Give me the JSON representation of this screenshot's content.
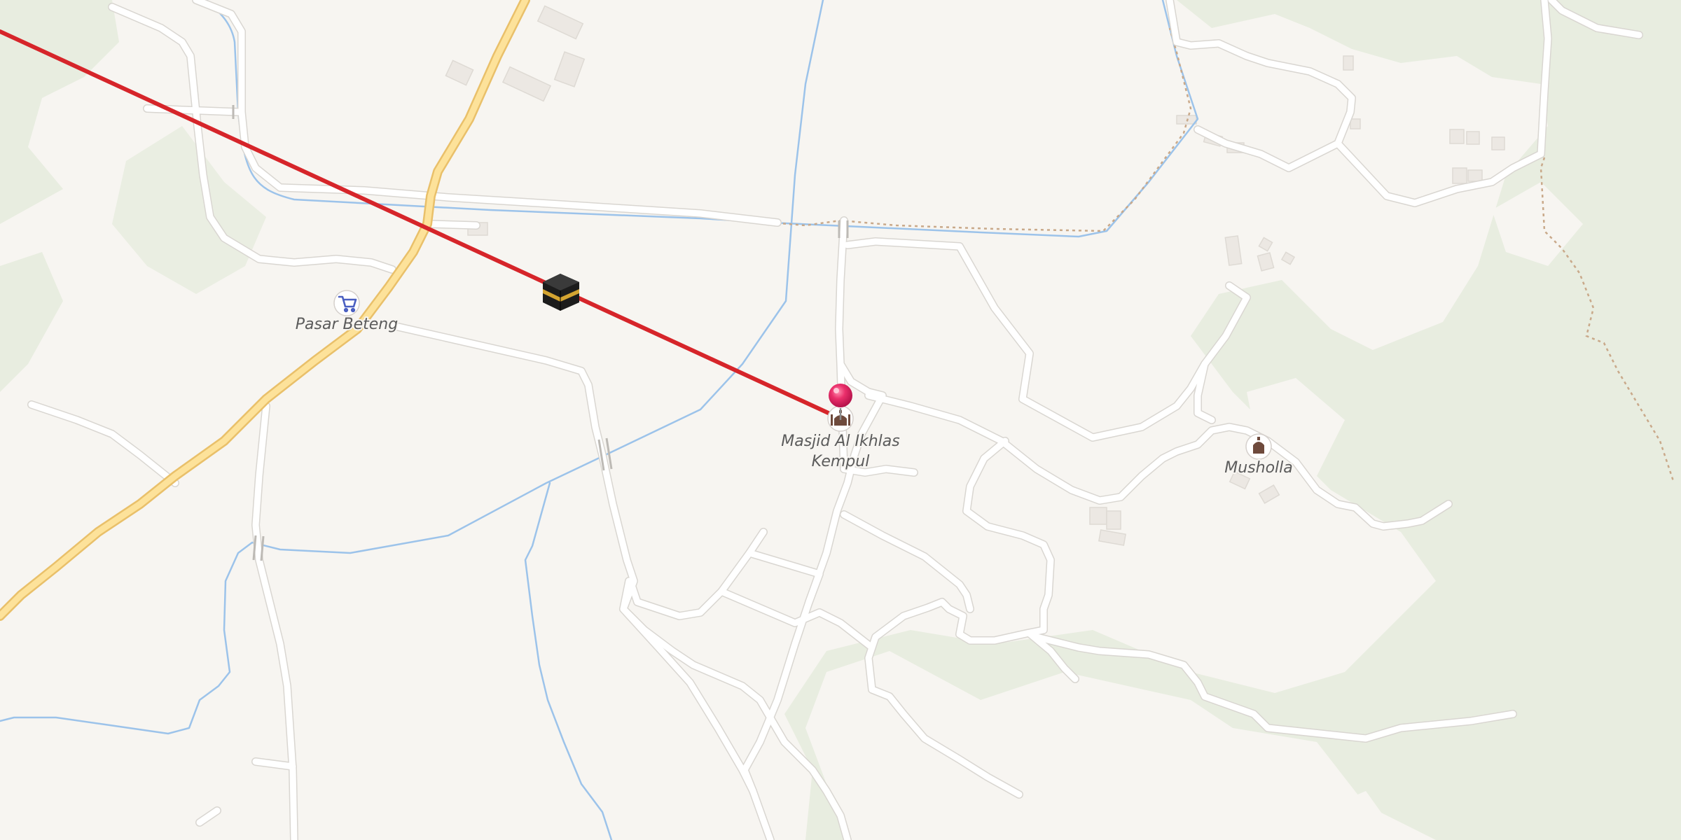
{
  "map": {
    "colors": {
      "land": "#f7f5f1",
      "forest": "#e8ede0",
      "water": "#9cc3ea",
      "main_road": "#fde29a",
      "main_road_edge": "#e9c06a",
      "qibla_line": "#d6252a",
      "pin": "#ea2f6b",
      "track": "#c9a98a"
    },
    "pois": [
      {
        "id": "pasar-beteng",
        "label": "Pasar Beteng",
        "icon": "shopping-cart-icon"
      },
      {
        "id": "masjid-al-ikhlas",
        "label_line1": "Masjid Al Ikhlas",
        "label_line2": "Kempul",
        "icon": "mosque-icon"
      },
      {
        "id": "musholla",
        "label": "Musholla",
        "icon": "prayer-room-icon"
      }
    ],
    "markers": {
      "kaaba": "kaaba-icon",
      "location_pin": "location-pin-icon"
    },
    "qibla_line": {
      "type": "qibla-direction-line"
    }
  }
}
